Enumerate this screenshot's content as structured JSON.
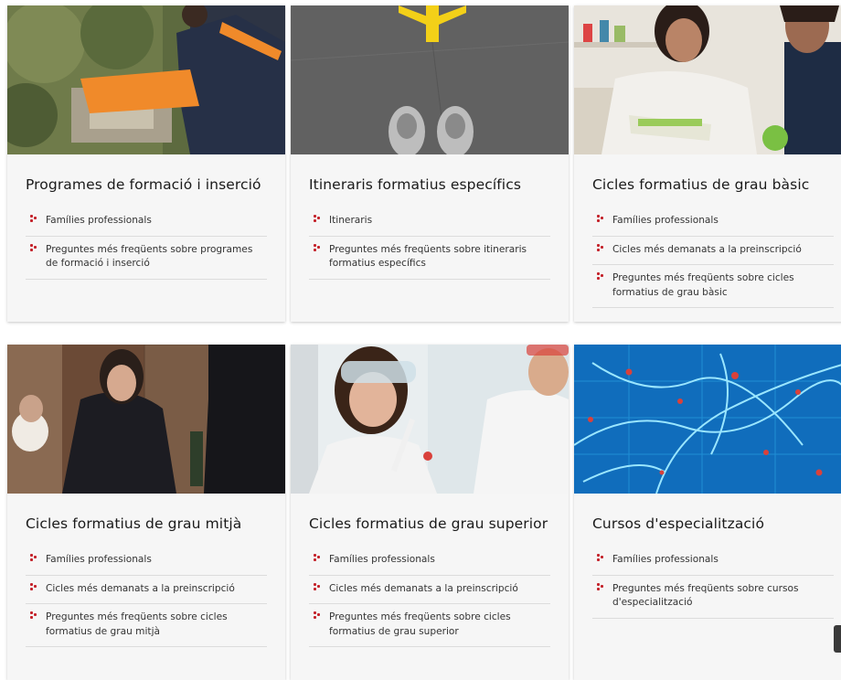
{
  "cards": [
    {
      "title": "Programes de formació i inserció",
      "links": [
        "Famílies professionals",
        "Preguntes més freqüents sobre programes de formació i inserció"
      ]
    },
    {
      "title": "Itineraris formatius específics",
      "links": [
        "Itineraris",
        "Preguntes més freqüents sobre itineraris formatius específics"
      ]
    },
    {
      "title": "Cicles formatius de grau bàsic",
      "links": [
        "Famílies professionals",
        "Cicles més demanats a la preinscripció",
        "Preguntes més freqüents sobre cicles formatius de grau bàsic"
      ]
    },
    {
      "title": "Cicles formatius de grau mitjà",
      "links": [
        "Famílies professionals",
        "Cicles més demanats a la preinscripció",
        "Preguntes més freqüents sobre cicles formatius de grau mitjà"
      ]
    },
    {
      "title": "Cicles formatius de grau superior",
      "links": [
        "Famílies professionals",
        "Cicles més demanats a la preinscripció",
        "Preguntes més freqüents sobre cicles formatius de grau superior"
      ]
    },
    {
      "title": "Cursos d'especialització",
      "links": [
        "Famílies professionals",
        "Preguntes més freqüents sobre cursos d'especialització"
      ]
    }
  ],
  "colors": {
    "accent": "#c4232b",
    "card_bg": "#f6f6f6",
    "divider": "#dcdcdc"
  },
  "icons": {
    "bullet": "bullet-dots-icon"
  }
}
